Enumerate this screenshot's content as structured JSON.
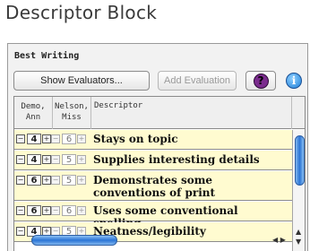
{
  "window": {
    "title": "Descriptor Block"
  },
  "section": {
    "title": "Best Writing"
  },
  "toolbar": {
    "show_evaluators_label": "Show Evaluators...",
    "add_evaluation_label": "Add Evaluation",
    "help_glyph": "?",
    "info_glyph": "i"
  },
  "icons": {
    "help": "help-icon",
    "info": "info-icon"
  },
  "colors": {
    "row_background": "#fffbd0",
    "help_button": "#7b2c8e",
    "info_button": "#1d7fd8",
    "scroll_thumb": "#2a74d6"
  },
  "table": {
    "headers": {
      "demo_line1": "Demo,",
      "demo_line2": "Ann",
      "nelson_line1": "Nelson,",
      "nelson_line2": "Miss",
      "descriptor": "Descriptor"
    },
    "rows": [
      {
        "demo": "4",
        "nelson": "6",
        "descriptor": "Stays on topic"
      },
      {
        "demo": "4",
        "nelson": "5",
        "descriptor": "Supplies interesting details"
      },
      {
        "demo": "6",
        "nelson": "5",
        "descriptor": "Demonstrates some conventions of print"
      },
      {
        "demo": "6",
        "nelson": "6",
        "descriptor": "Uses some conventional spelling"
      },
      {
        "demo": "4",
        "nelson": "5",
        "descriptor": "Neatness/legibility"
      }
    ]
  }
}
